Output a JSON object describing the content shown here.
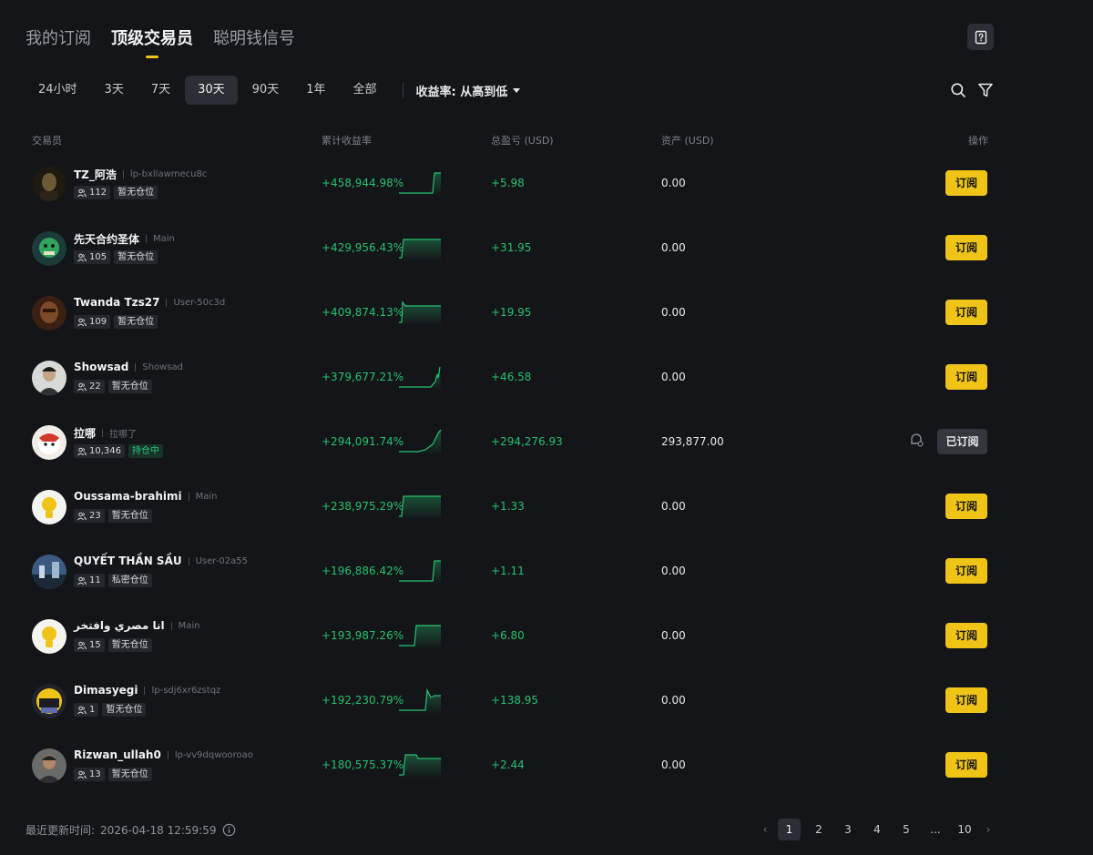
{
  "top_tabs": [
    "我的订阅",
    "顶级交易员",
    "聪明钱信号"
  ],
  "periods": [
    "24小时",
    "3天",
    "7天",
    "30天",
    "90天",
    "1年",
    "全部"
  ],
  "sort_label": "收益率: 从高到低",
  "columns": {
    "trader": "交易员",
    "roi": "累计收益率",
    "pnl": "总盈亏 (USD)",
    "assets": "资产 (USD)",
    "action": "操作"
  },
  "traders": [
    {
      "name": "TZ_阿浩",
      "sub": "lp-bxllawmecu8c",
      "followers": "112",
      "status": "暂无仓位",
      "roi": "+458,944.98%",
      "pnl": "+5.98",
      "assets": "0.00",
      "action": "订阅"
    },
    {
      "name": "先天合约圣体",
      "sub": "Main",
      "followers": "105",
      "status": "暂无仓位",
      "roi": "+429,956.43%",
      "pnl": "+31.95",
      "assets": "0.00",
      "action": "订阅"
    },
    {
      "name": "Twanda Tzs27",
      "sub": "User-50c3d",
      "followers": "109",
      "status": "暂无仓位",
      "roi": "+409,874.13%",
      "pnl": "+19.95",
      "assets": "0.00",
      "action": "订阅"
    },
    {
      "name": "Showsad",
      "sub": "Showsad",
      "followers": "22",
      "status": "暂无仓位",
      "roi": "+379,677.21%",
      "pnl": "+46.58",
      "assets": "0.00",
      "action": "订阅"
    },
    {
      "name": "拉哪",
      "sub": "拉哪了",
      "followers": "10,346",
      "status": "持仓中",
      "roi": "+294,091.74%",
      "pnl": "+294,276.93",
      "assets": "293,877.00",
      "action": "已订阅"
    },
    {
      "name": "Oussama-brahimi",
      "sub": "Main",
      "followers": "23",
      "status": "暂无仓位",
      "roi": "+238,975.29%",
      "pnl": "+1.33",
      "assets": "0.00",
      "action": "订阅"
    },
    {
      "name": "QUYẾT THẦN SẦU",
      "sub": "User-02a55",
      "followers": "11",
      "status": "私密仓位",
      "roi": "+196,886.42%",
      "pnl": "+1.11",
      "assets": "0.00",
      "action": "订阅"
    },
    {
      "name": "انا مصري وافتخر",
      "sub": "Main",
      "followers": "15",
      "status": "暂无仓位",
      "roi": "+193,987.26%",
      "pnl": "+6.80",
      "assets": "0.00",
      "action": "订阅"
    },
    {
      "name": "Dimasyegi",
      "sub": "lp-sdj6xr6zstqz",
      "followers": "1",
      "status": "暂无仓位",
      "roi": "+192,230.79%",
      "pnl": "+138.95",
      "assets": "0.00",
      "action": "订阅"
    },
    {
      "name": "Rizwan_ullah0",
      "sub": "lp-vv9dqwooroao",
      "followers": "13",
      "status": "暂无仓位",
      "roi": "+180,575.37%",
      "pnl": "+2.44",
      "assets": "0.00",
      "action": "订阅"
    }
  ],
  "footer": {
    "updated_label": "最近更新时间:",
    "updated_time": "2026-04-18 12:59:59"
  },
  "pagination": [
    "1",
    "2",
    "3",
    "4",
    "5",
    "...",
    "10"
  ],
  "colors": {
    "accent": "#f0c417",
    "positive": "#25c06f",
    "background": "#141518"
  }
}
